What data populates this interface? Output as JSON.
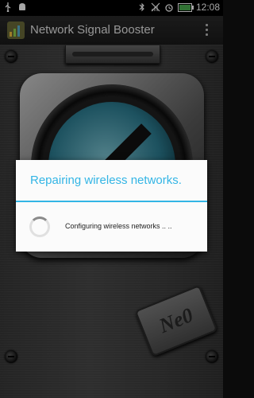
{
  "status_bar": {
    "time": "12:08",
    "battery_level": 0.85,
    "icons_left": [
      "usb-icon",
      "android-icon"
    ],
    "icons_right": [
      "bluetooth-icon",
      "signal-off-icon",
      "alarm-icon",
      "battery-icon"
    ]
  },
  "action_bar": {
    "title": "Network Signal Booster"
  },
  "dialog": {
    "title": "Repairing wireless networks.",
    "message": "Configuring wireless networks .. .."
  },
  "badge": {
    "text": "Ne0"
  },
  "colors": {
    "accent": "#33b5e5",
    "dialog_bg": "#fbfbfb"
  }
}
